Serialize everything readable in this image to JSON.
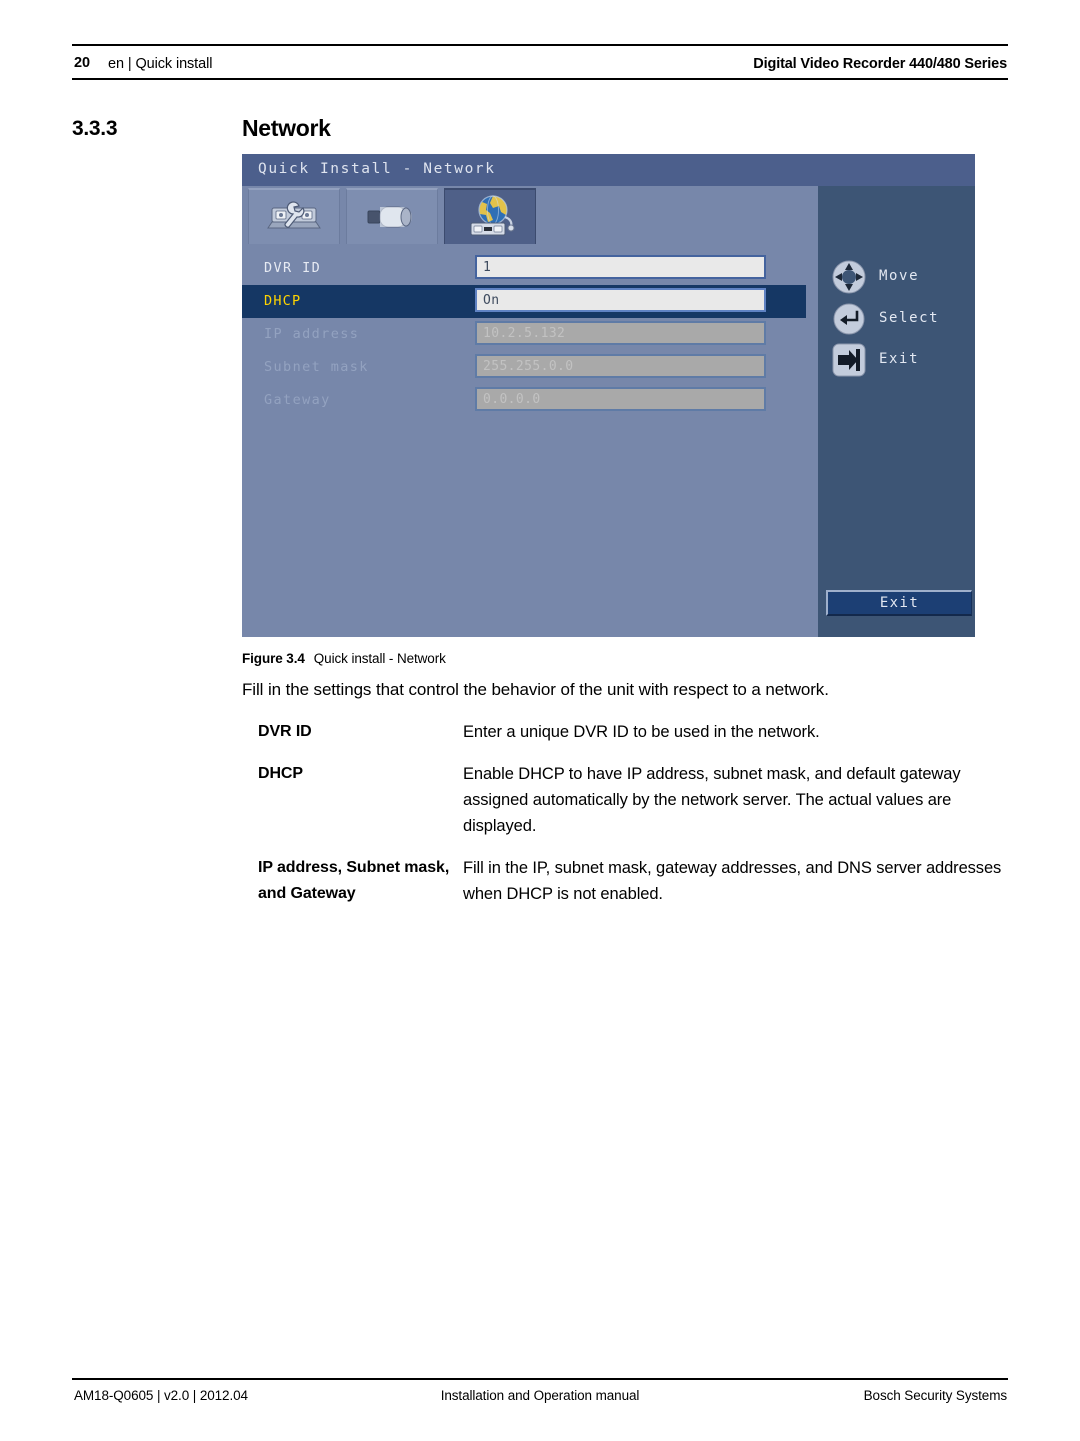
{
  "header": {
    "page_number": "20",
    "section": "en | Quick install",
    "product": "Digital Video Recorder 440/480 Series"
  },
  "section": {
    "number": "3.3.3",
    "title": "Network"
  },
  "screenshot": {
    "titlebar": "Quick Install - Network",
    "tabs": [
      {
        "icon": "tools-wrench-icon",
        "selected": false
      },
      {
        "icon": "camera-icon",
        "selected": false
      },
      {
        "icon": "network-globe-icon",
        "selected": true
      }
    ],
    "rows": [
      {
        "label": "DVR ID",
        "value": "1",
        "state": "normal"
      },
      {
        "label": "DHCP",
        "value": "On",
        "state": "selected"
      },
      {
        "label": "IP address",
        "value": "10.2.5.132",
        "state": "disabled"
      },
      {
        "label": "Subnet mask",
        "value": "255.255.0.0",
        "state": "disabled"
      },
      {
        "label": "Gateway",
        "value": "0.0.0.0",
        "state": "disabled"
      }
    ],
    "legend": [
      {
        "icon": "dpad-move-icon",
        "label": "Move"
      },
      {
        "icon": "enter-select-icon",
        "label": "Select"
      },
      {
        "icon": "exit-arrow-icon",
        "label": "Exit"
      }
    ],
    "exit_button": "Exit",
    "colors": {
      "panel_background": "#7787aa",
      "titlebar": "#4c5f8c",
      "sidebar": "#3d5575",
      "selected_row": "#153764",
      "selected_label": "#ffd400",
      "field_background": "#e9e9e9",
      "field_disabled": "#a9a9a9",
      "exit_button": "#1c3f74"
    }
  },
  "figure": {
    "label": "Figure 3.4",
    "caption": "Quick install - Network"
  },
  "body": {
    "intro": "Fill in the settings that control the behavior of the unit with respect to a network.",
    "definitions": [
      {
        "term": "DVR ID",
        "description": "Enter a unique DVR ID to be used in the network."
      },
      {
        "term": "DHCP",
        "description": "Enable DHCP to have IP address, subnet mask, and default gateway assigned automatically by the network server. The actual values are displayed."
      },
      {
        "term": "IP address, Subnet mask, and Gateway",
        "description": "Fill in the IP, subnet mask, gateway addresses, and DNS server addresses when DHCP is not enabled."
      }
    ]
  },
  "footer": {
    "left": "AM18-Q0605 | v2.0 | 2012.04",
    "center": "Installation and Operation manual",
    "right": "Bosch Security Systems"
  }
}
